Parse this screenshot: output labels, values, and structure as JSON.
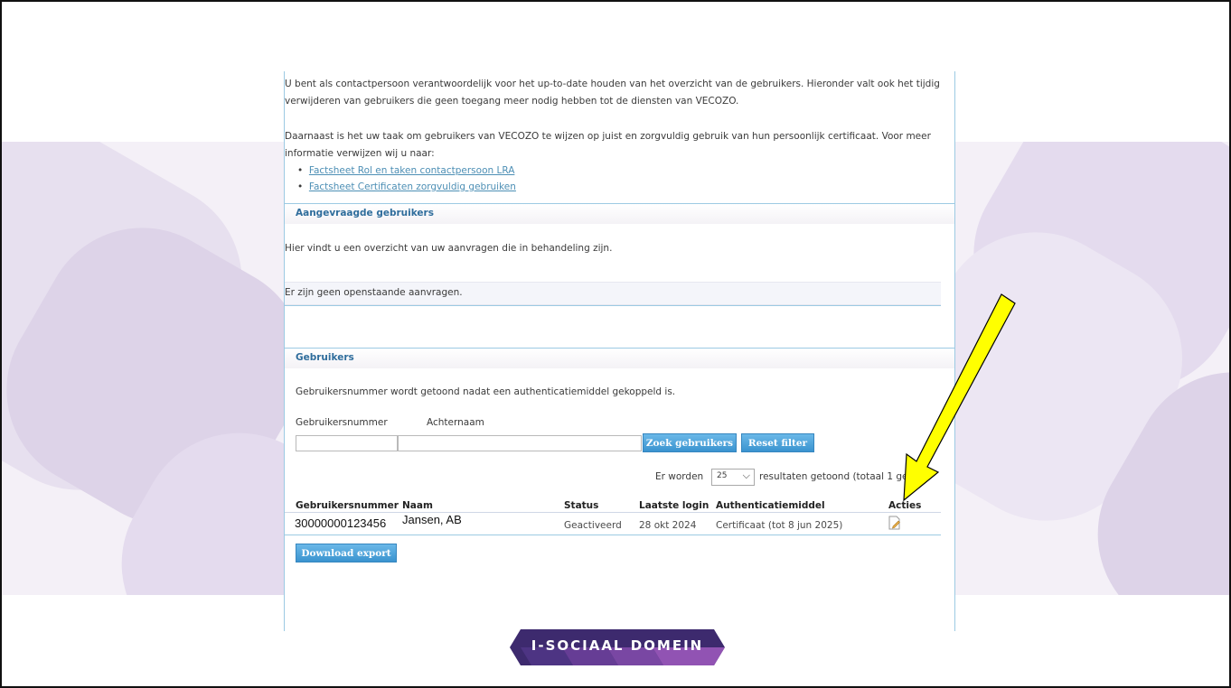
{
  "intro": {
    "para1_line1": "U bent als contactpersoon verantwoordelijk voor het up-to-date houden van het overzicht van de gebruikers. Hieronder valt ook het tijdig",
    "para1_line2": "verwijderen van gebruikers die geen toegang meer nodig hebben tot de diensten van VECOZO.",
    "para2_line1": "Daarnaast is het uw taak om gebruikers van VECOZO te wijzen op juist en zorgvuldig gebruik van hun persoonlijk certificaat. Voor meer",
    "para2_line2": "informatie verwijzen wij u naar:",
    "links": [
      "Factsheet Rol en taken contactpersoon LRA",
      "Factsheet Certificaten zorgvuldig gebruiken"
    ]
  },
  "requested": {
    "heading": "Aangevraagde gebruikers",
    "description": "Hier vindt u een overzicht van uw aanvragen die in behandeling zijn.",
    "empty_message": "Er zijn geen openstaande aanvragen."
  },
  "users": {
    "heading": "Gebruikers",
    "note": "Gebruikersnummer wordt getoond nadat een authenticatiemiddel gekoppeld is.",
    "filter_label_number": "Gebruikersnummer",
    "filter_label_lastname": "Achternaam",
    "filter_value_number": "",
    "filter_value_lastname": "",
    "search_button": "Zoek gebruikers",
    "reset_button": "Reset filter",
    "results_prefix": "Er worden",
    "page_size": "25",
    "results_suffix": "resultaten getoond (totaal 1 gev",
    "columns": [
      "Gebruikersnummer",
      "Naam",
      "Status",
      "Laatste login",
      "Authenticatiemiddel",
      "Acties"
    ],
    "rows": [
      {
        "number": "30000000123456",
        "name": "Jansen, AB",
        "status": "Geactiveerd",
        "last_login": "28 okt 2024",
        "auth": "Certificaat (tot 8 jun 2025)",
        "action_icon": "edit-document-icon"
      }
    ],
    "export_button": "Download export"
  },
  "annotation": {
    "arrow_color": "#ffff00",
    "arrow_outline": "#000000"
  },
  "logo": {
    "text": "I-SOCIAAL DOMEIN",
    "colors": [
      "#3d2a6e",
      "#5a3a8c",
      "#7a4aa6",
      "#a05cc0"
    ]
  }
}
